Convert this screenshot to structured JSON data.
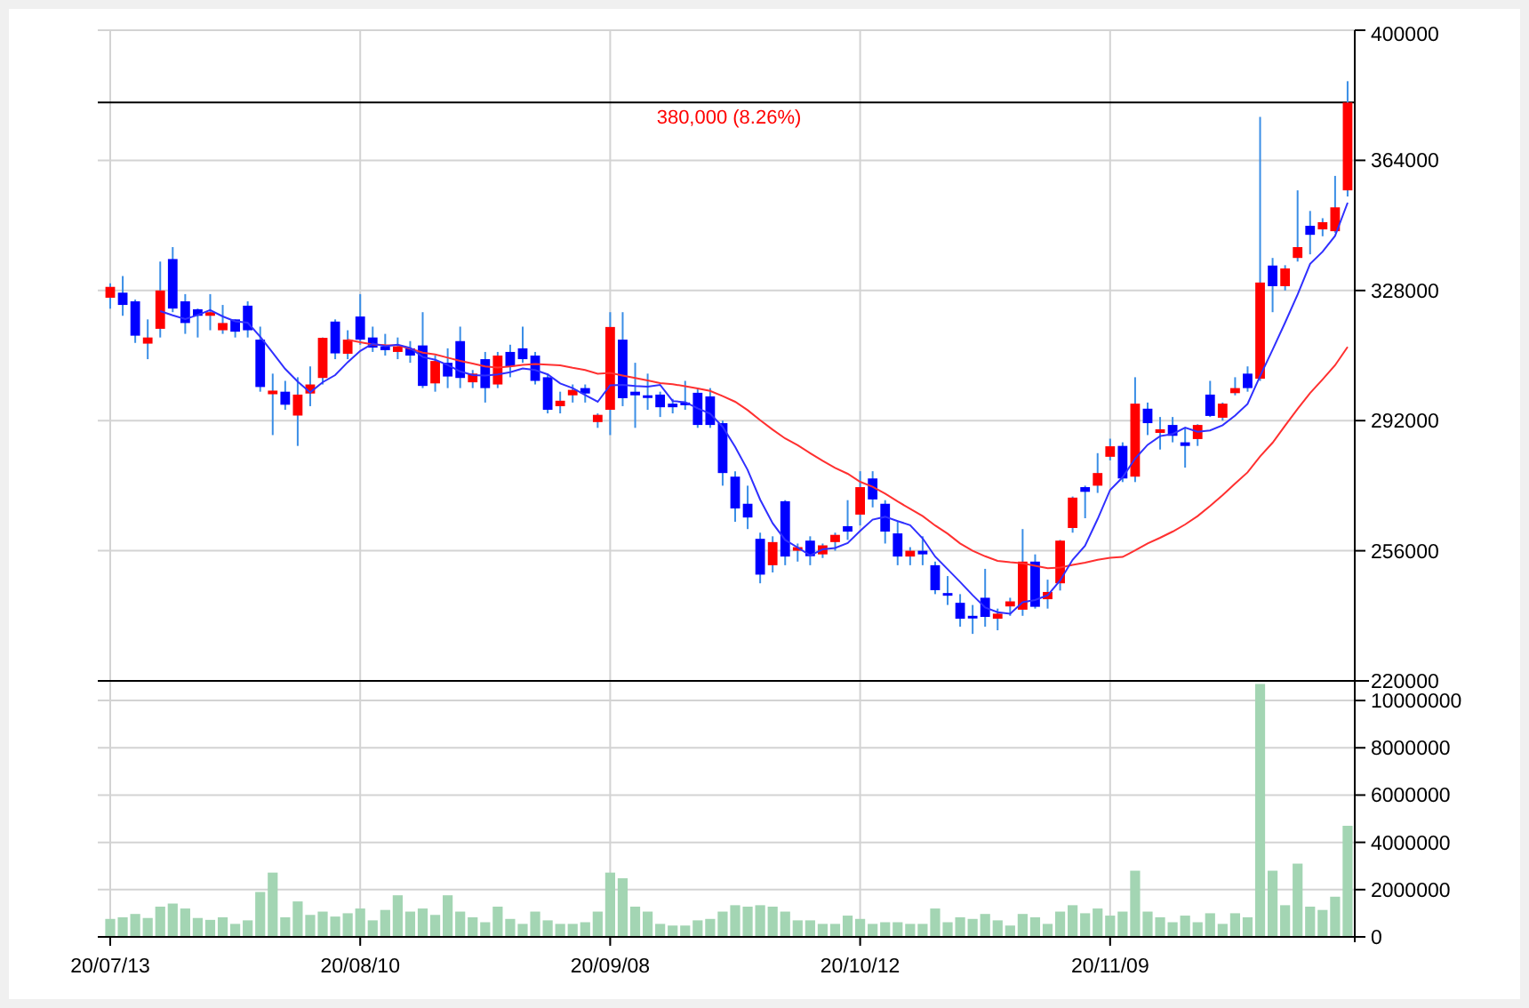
{
  "price_chart": {
    "chart_data": {
      "type": "candlestick",
      "grid": true,
      "ylim": [
        220000,
        400000
      ],
      "yticks": [
        220000,
        256000,
        292000,
        328000,
        364000,
        400000
      ],
      "categories": [
        null,
        null,
        null,
        null,
        null,
        null,
        null,
        null,
        null,
        null,
        null,
        null,
        null,
        null,
        null,
        null,
        null,
        null,
        null,
        null,
        null,
        null,
        null,
        null,
        null,
        null,
        null,
        null,
        null,
        null,
        null,
        null,
        null,
        null,
        null,
        null,
        null,
        null,
        null,
        null,
        null,
        null,
        null,
        null,
        null,
        null,
        null,
        null,
        null,
        null,
        null,
        null,
        null,
        null,
        null,
        null,
        null,
        null,
        null,
        null,
        null,
        null,
        null,
        null,
        null,
        null,
        null,
        null,
        null,
        null,
        null,
        null,
        null,
        null,
        null,
        null,
        null,
        null,
        null,
        null,
        null,
        null,
        null,
        null,
        null,
        null,
        null,
        null,
        null,
        null,
        null,
        null,
        null,
        null,
        null,
        null,
        null,
        null,
        null,
        null
      ],
      "ohlc": [
        [
          326000,
          330000,
          323000,
          329000
        ],
        [
          327400,
          332000,
          321000,
          324000
        ],
        [
          325000,
          325500,
          313500,
          315500
        ],
        [
          313300,
          320000,
          309000,
          315000
        ],
        [
          317400,
          336000,
          315000,
          328000
        ],
        [
          336700,
          340000,
          322000,
          323000
        ],
        [
          325000,
          327000,
          316000,
          319000
        ],
        [
          322800,
          323000,
          315000,
          321000
        ],
        [
          321000,
          327000,
          317000,
          322000
        ],
        [
          317000,
          324000,
          316000,
          319000
        ],
        [
          320000,
          320000,
          315000,
          316600
        ],
        [
          323800,
          325000,
          315000,
          317000
        ],
        [
          314400,
          318000,
          300000,
          301300
        ],
        [
          299300,
          305000,
          288000,
          300300
        ],
        [
          300000,
          303000,
          295000,
          296400
        ],
        [
          293400,
          304000,
          285000,
          299200
        ],
        [
          299500,
          307000,
          296000,
          302000
        ],
        [
          303800,
          315000,
          302000,
          314900
        ],
        [
          319400,
          320000,
          309000,
          310600
        ],
        [
          310500,
          317000,
          309000,
          314400
        ],
        [
          320800,
          327000,
          313000,
          314400
        ],
        [
          315000,
          318000,
          311000,
          312200
        ],
        [
          312500,
          316000,
          310000,
          311500
        ],
        [
          311000,
          315000,
          309000,
          312500
        ],
        [
          312000,
          314000,
          308000,
          310000
        ],
        [
          312800,
          322000,
          301000,
          301600
        ],
        [
          302300,
          310000,
          300000,
          308500
        ],
        [
          308000,
          312000,
          301000,
          304200
        ],
        [
          314000,
          318000,
          301000,
          303800
        ],
        [
          302600,
          306000,
          301000,
          305000
        ],
        [
          309000,
          311000,
          297000,
          301000
        ],
        [
          302000,
          311000,
          301000,
          310000
        ],
        [
          311000,
          313000,
          304000,
          307000
        ],
        [
          312000,
          318000,
          308000,
          309000
        ],
        [
          310000,
          311000,
          302000,
          303000
        ],
        [
          304000,
          305000,
          294000,
          295000
        ],
        [
          296000,
          300000,
          294000,
          297500
        ],
        [
          299000,
          302000,
          297000,
          300500
        ],
        [
          301000,
          302000,
          297000,
          299500
        ],
        [
          291600,
          294000,
          290000,
          293600
        ],
        [
          295000,
          322000,
          288000,
          317900
        ],
        [
          314400,
          322000,
          296000,
          298200
        ],
        [
          300000,
          308000,
          290000,
          299000
        ],
        [
          299000,
          305000,
          295000,
          298500
        ],
        [
          299200,
          300000,
          293000,
          295700
        ],
        [
          296700,
          298000,
          294000,
          295700
        ],
        [
          297000,
          303000,
          295000,
          296500
        ],
        [
          299700,
          301000,
          290000,
          290800
        ],
        [
          298700,
          301000,
          290000,
          290800
        ],
        [
          291300,
          292000,
          274000,
          277500
        ],
        [
          276500,
          278000,
          264000,
          267700
        ],
        [
          269000,
          274000,
          262000,
          265200
        ],
        [
          259300,
          261000,
          247000,
          249400
        ],
        [
          252000,
          260000,
          250000,
          258400
        ],
        [
          269700,
          270000,
          252000,
          254400
        ],
        [
          256000,
          258000,
          253000,
          257000
        ],
        [
          258800,
          260000,
          252000,
          254500
        ],
        [
          255000,
          258000,
          254000,
          257500
        ],
        [
          258400,
          261000,
          256000,
          260400
        ],
        [
          262800,
          270000,
          259000,
          261300
        ],
        [
          266000,
          278000,
          263000,
          273600
        ],
        [
          276000,
          278000,
          268000,
          270200
        ],
        [
          269000,
          270000,
          258000,
          261300
        ],
        [
          260800,
          264000,
          252000,
          254400
        ],
        [
          254400,
          257000,
          252000,
          256000
        ],
        [
          256000,
          260000,
          252000,
          255000
        ],
        [
          252000,
          253000,
          244000,
          245100
        ],
        [
          244300,
          249000,
          241000,
          243800
        ],
        [
          241600,
          244000,
          235000,
          237200
        ],
        [
          238000,
          241000,
          233000,
          237500
        ],
        [
          243000,
          251000,
          235000,
          237700
        ],
        [
          237200,
          240000,
          234000,
          238600
        ],
        [
          240600,
          243000,
          238000,
          242000
        ],
        [
          239700,
          262000,
          238000,
          253000
        ],
        [
          253000,
          255000,
          240000,
          240500
        ],
        [
          242600,
          248000,
          240000,
          244600
        ],
        [
          247000,
          259000,
          245000,
          258800
        ],
        [
          262300,
          271000,
          261000,
          270700
        ],
        [
          273600,
          274000,
          265000,
          272300
        ],
        [
          274000,
          283000,
          272000,
          277500
        ],
        [
          282000,
          287000,
          281000,
          284900
        ],
        [
          285000,
          286000,
          275000,
          276000
        ],
        [
          276500,
          304000,
          275000,
          296700
        ],
        [
          295300,
          297000,
          288000,
          291300
        ],
        [
          288600,
          293000,
          284000,
          289600
        ],
        [
          290800,
          293000,
          286000,
          287800
        ],
        [
          286000,
          290000,
          279000,
          285000
        ],
        [
          286900,
          291000,
          285000,
          290800
        ],
        [
          299200,
          303000,
          293000,
          293300
        ],
        [
          292800,
          297000,
          292000,
          296700
        ],
        [
          299600,
          304000,
          299000,
          301000
        ],
        [
          305000,
          307000,
          300000,
          301000
        ],
        [
          303600,
          376000,
          303000,
          330200
        ],
        [
          334900,
          337000,
          322000,
          329200
        ],
        [
          329200,
          335000,
          328000,
          334100
        ],
        [
          337000,
          355700,
          336000,
          340000
        ],
        [
          345900,
          350000,
          338000,
          343400
        ],
        [
          344900,
          348000,
          343000,
          346900
        ],
        [
          344400,
          359700,
          344000,
          351000
        ],
        [
          355700,
          385900,
          354000,
          380000
        ]
      ],
      "series": [
        {
          "type": "line",
          "color": "#ff3030",
          "values": [
            null,
            null,
            null,
            null,
            null,
            null,
            null,
            null,
            null,
            null,
            null,
            null,
            null,
            null,
            null,
            null,
            null,
            null,
            null,
            314400,
            313700,
            313100,
            312900,
            312800,
            311900,
            310800,
            310300,
            309400,
            308500,
            307800,
            307000,
            306700,
            307000,
            307400,
            307700,
            307500,
            307300,
            306600,
            306000,
            305000,
            305200,
            304500,
            303800,
            303100,
            302400,
            302100,
            301500,
            300900,
            300200,
            298800,
            297200,
            294900,
            292100,
            289500,
            287100,
            285200,
            283000,
            280900,
            278900,
            277300,
            275100,
            273700,
            271800,
            269600,
            267600,
            265600,
            263000,
            260700,
            258000,
            256000,
            254500,
            253200,
            252800,
            252500,
            251800,
            251200,
            251400,
            252100,
            252700,
            253500,
            254100,
            254300,
            256100,
            258000,
            259600,
            261300,
            263300,
            265600,
            268400,
            271400,
            274600,
            277700,
            282100,
            285900,
            290600,
            295300,
            299600,
            303400,
            307300,
            312400
          ]
        },
        {
          "type": "line",
          "color": "#3030ff",
          "values": [
            null,
            null,
            null,
            null,
            322300,
            321100,
            320100,
            321200,
            322600,
            320800,
            319500,
            319100,
            315200,
            310800,
            306300,
            302800,
            299800,
            302600,
            304600,
            308200,
            311300,
            313300,
            312600,
            313000,
            312100,
            309600,
            308800,
            307400,
            305600,
            304600,
            304500,
            304800,
            305400,
            306400,
            306000,
            304800,
            302300,
            301000,
            299100,
            297200,
            301800,
            301900,
            301600,
            301400,
            301900,
            297400,
            297100,
            295400,
            293900,
            290300,
            284700,
            278400,
            270100,
            263600,
            259000,
            256900,
            254700,
            256400,
            256800,
            258100,
            261500,
            264600,
            265400,
            264200,
            263100,
            259400,
            254400,
            250900,
            247400,
            243700,
            240300,
            239000,
            238600,
            241800,
            242400,
            243700,
            247800,
            253500,
            257400,
            264800,
            272800,
            276300,
            281500,
            285300,
            287700,
            288300,
            290100,
            288900,
            289300,
            290700,
            293400,
            296600,
            304400,
            311600,
            319100,
            326900,
            335400,
            338700,
            343100,
            352300
          ]
        }
      ],
      "ref_lines": [
        {
          "axis": "y",
          "value": 380000,
          "label": "380,000 (8.26%)"
        }
      ]
    }
  },
  "volume_chart": {
    "chart_data": {
      "type": "bar",
      "grid": true,
      "ylim": [
        0,
        10800000
      ],
      "yticks": [
        0,
        2000000,
        4000000,
        6000000,
        8000000,
        10000000
      ],
      "categories": [
        "20/07/13",
        null,
        null,
        null,
        null,
        null,
        null,
        null,
        null,
        null,
        null,
        null,
        null,
        null,
        null,
        null,
        null,
        null,
        null,
        null,
        "20/08/10",
        null,
        null,
        null,
        null,
        null,
        null,
        null,
        null,
        null,
        null,
        null,
        null,
        null,
        null,
        null,
        null,
        null,
        null,
        null,
        "20/09/08",
        null,
        null,
        null,
        null,
        null,
        null,
        null,
        null,
        null,
        null,
        null,
        null,
        null,
        null,
        null,
        null,
        null,
        null,
        null,
        "20/10/12",
        null,
        null,
        null,
        null,
        null,
        null,
        null,
        null,
        null,
        null,
        null,
        null,
        null,
        null,
        null,
        null,
        null,
        null,
        null,
        "20/11/09",
        null,
        null,
        null,
        null,
        null,
        null,
        null,
        null,
        null,
        null,
        null,
        null,
        null,
        null,
        null,
        null,
        null,
        null,
        null
      ],
      "values": [
        760000,
        830000,
        970000,
        800000,
        1280000,
        1410000,
        1200000,
        800000,
        720000,
        830000,
        550000,
        700000,
        1900000,
        2720000,
        830000,
        1500000,
        930000,
        1070000,
        860000,
        1000000,
        1200000,
        700000,
        1140000,
        1760000,
        1070000,
        1200000,
        930000,
        1760000,
        1070000,
        830000,
        620000,
        1280000,
        760000,
        550000,
        1070000,
        700000,
        550000,
        550000,
        620000,
        1070000,
        2720000,
        2480000,
        1280000,
        1070000,
        550000,
        480000,
        480000,
        700000,
        760000,
        1070000,
        1340000,
        1280000,
        1340000,
        1280000,
        1070000,
        700000,
        700000,
        550000,
        550000,
        900000,
        760000,
        550000,
        620000,
        620000,
        550000,
        550000,
        1200000,
        620000,
        830000,
        760000,
        970000,
        700000,
        480000,
        970000,
        830000,
        550000,
        1070000,
        1340000,
        1000000,
        1200000,
        900000,
        1070000,
        2800000,
        1070000,
        830000,
        620000,
        900000,
        620000,
        1000000,
        550000,
        1000000,
        830000,
        10700000,
        2800000,
        1340000,
        3100000,
        1280000,
        1140000,
        1700000,
        4700000
      ]
    }
  }
}
